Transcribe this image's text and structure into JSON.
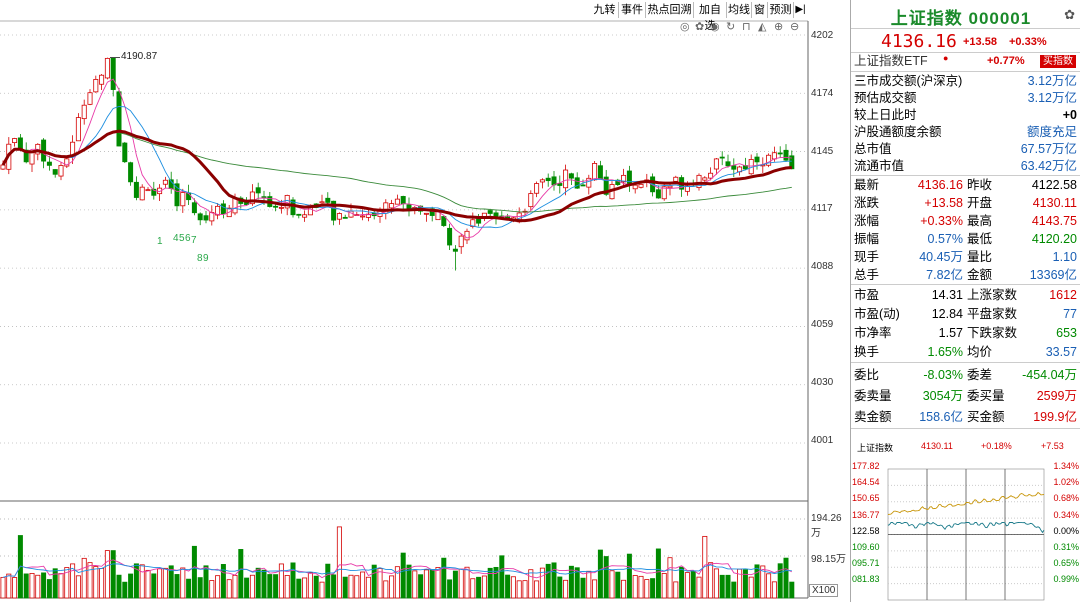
{
  "toolbar": {
    "buttons": [
      "九转",
      "事件",
      "热点回溯",
      "加自选",
      "均线",
      "窗",
      "预测"
    ],
    "arrow_icon": "play-end-icon"
  },
  "chart": {
    "y_labels": [
      "4202",
      "4174",
      "4145",
      "4117",
      "4088",
      "4059",
      "4030",
      "4001"
    ],
    "high_annotation": "4190.87",
    "markers": [
      "1",
      "4",
      "5",
      "6",
      "7",
      "8",
      "9"
    ],
    "volume_labels": [
      "194.26万",
      "98.15万",
      "X100"
    ],
    "colors": {
      "up": "#d40000",
      "down": "#008a00",
      "ma_thick": "#8b0000"
    }
  },
  "chart_data": {
    "type": "candlestick",
    "ylim": [
      4001,
      4202
    ],
    "high_mark": 4190.87,
    "volume_ticks": [
      "194.26万",
      "98.15万"
    ],
    "unit": "X100"
  },
  "quote": {
    "name_code": "上证指数 000001",
    "price": "4136.16",
    "change": "+13.58",
    "change_pct": "+0.33%",
    "etf_label": "上证指数ETF",
    "etf_pct": "+0.77%",
    "buy_btn": "买指数",
    "info": [
      {
        "label": "三市成交额(沪深京)",
        "value": "3.12万亿"
      },
      {
        "label": "预估成交额",
        "value": "3.12万亿"
      },
      {
        "label": "较上日此时",
        "value": "+0"
      },
      {
        "label": "沪股通额度余额",
        "value": "额度充足"
      },
      {
        "label": "总市值",
        "value": "67.57万亿"
      },
      {
        "label": "流通市值",
        "value": "63.42万亿"
      }
    ],
    "grid1": [
      {
        "l1": "最新",
        "v1": "4136.16",
        "l2": "昨收",
        "v2": "4122.58"
      },
      {
        "l1": "涨跌",
        "v1": "+13.58",
        "l2": "开盘",
        "v2": "4130.11"
      },
      {
        "l1": "涨幅",
        "v1": "+0.33%",
        "l2": "最高",
        "v2": "4143.75"
      },
      {
        "l1": "振幅",
        "v1": "0.57%",
        "l2": "最低",
        "v2": "4120.20"
      },
      {
        "l1": "现手",
        "v1": "40.45万",
        "l2": "量比",
        "v2": "1.10"
      },
      {
        "l1": "总手",
        "v1": "7.82亿",
        "l2": "金额",
        "v2": "13369亿"
      }
    ],
    "grid2": [
      {
        "l1": "市盈",
        "v1": "14.31",
        "l2": "上涨家数",
        "v2": "1612"
      },
      {
        "l1": "市盈(动)",
        "v1": "12.84",
        "l2": "平盘家数",
        "v2": "77"
      },
      {
        "l1": "市净率",
        "v1": "1.57",
        "l2": "下跌家数",
        "v2": "653"
      },
      {
        "l1": "换手",
        "v1": "1.65%",
        "l2": "均价",
        "v2": "33.57"
      }
    ],
    "grid3": [
      {
        "l1": "委比",
        "v1": "-8.03%",
        "l2": "委差",
        "v2": "-454.04万"
      },
      {
        "l1": "委卖量",
        "v1": "3054万",
        "l2": "委买量",
        "v2": "2599万"
      },
      {
        "l1": "卖金额",
        "v1": "158.6亿",
        "l2": "买金额",
        "v2": "199.9亿"
      }
    ]
  },
  "mini_chart": {
    "title": "上证指数",
    "price": "4130.11",
    "pct": "+0.18%",
    "change": "+7.53",
    "left_labels": [
      "177.82",
      "164.54",
      "150.65",
      "136.77",
      "122.58",
      "109.60",
      "095.71",
      "081.83"
    ],
    "right_labels": [
      "1.34%",
      "1.02%",
      "0.68%",
      "0.34%",
      "0.00%",
      "0.31%",
      "0.65%",
      "0.99%"
    ]
  }
}
